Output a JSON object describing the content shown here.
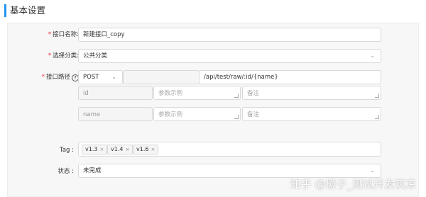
{
  "section": {
    "title": "基本设置"
  },
  "form": {
    "name": {
      "label": "接口名称:",
      "value": "新建接口_copy"
    },
    "category": {
      "label": "选择分类:",
      "value": "公共分类"
    },
    "path": {
      "label": "接口路径",
      "help": "?",
      "method": "POST",
      "base": "",
      "value": "/api/test/raw/:id/{name}",
      "params": [
        {
          "name": "id",
          "example_placeholder": "参数示例",
          "note_placeholder": "备注"
        },
        {
          "name": "name",
          "example_placeholder": "参数示例",
          "note_placeholder": "备注"
        }
      ]
    },
    "tag": {
      "label": "Tag :",
      "items": [
        {
          "label": "v1.3",
          "remove": "×"
        },
        {
          "label": "v1.4",
          "remove": "×"
        },
        {
          "label": "v1.6",
          "remove": "×"
        }
      ]
    },
    "status": {
      "label": "状态 :",
      "value": "未完成"
    }
  },
  "watermark": "知乎 @橙子_测试开发筑凉",
  "colors": {
    "accent": "#2395f1",
    "required": "#f5222d"
  },
  "icons": {
    "chevron": "chevron-down-icon",
    "help": "help-circle-icon",
    "remove": "close-icon"
  }
}
